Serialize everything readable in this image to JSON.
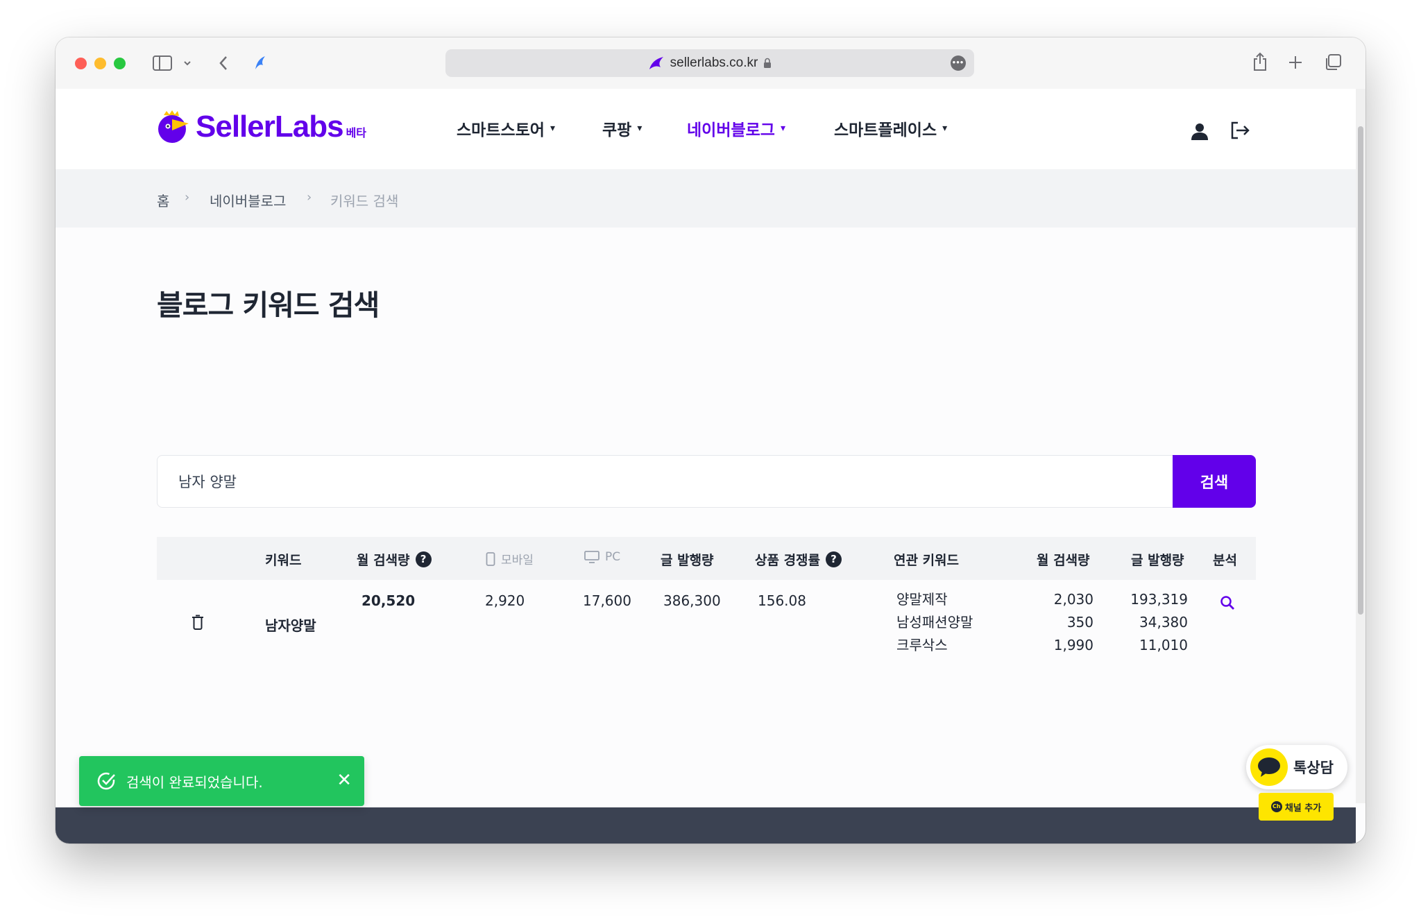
{
  "browser": {
    "url": "sellerlabs.co.kr",
    "more_icon": "ellipsis-icon"
  },
  "header": {
    "logo_text": "SellerLabs",
    "logo_badge": "베타",
    "nav": [
      {
        "label": "스마트스토어",
        "active": false
      },
      {
        "label": "쿠팡",
        "active": false
      },
      {
        "label": "네이버블로그",
        "active": true
      },
      {
        "label": "스마트플레이스",
        "active": false
      }
    ],
    "accent": "#6200ea"
  },
  "breadcrumb": {
    "home": "홈",
    "section": "네이버블로그",
    "current": "키워드 검색"
  },
  "page": {
    "title": "블로그 키워드 검색"
  },
  "search": {
    "value": "남자 양말",
    "button": "검색"
  },
  "table": {
    "headers": {
      "keyword": "키워드",
      "monthly_search": "월 검색량",
      "mobile": "모바일",
      "pc": "PC",
      "posts": "글 발행량",
      "competition": "상품 경쟁률",
      "related": "연관 키워드",
      "related_monthly": "월 검색량",
      "related_posts": "글 발행량",
      "analysis": "분석"
    },
    "row": {
      "keyword": "남자양말",
      "monthly_search": "20,520",
      "mobile": "2,920",
      "pc": "17,600",
      "posts": "386,300",
      "competition": "156.08",
      "related": [
        {
          "keyword": "양말제작",
          "monthly": "2,030",
          "posts": "193,319"
        },
        {
          "keyword": "남성패션양말",
          "monthly": "350",
          "posts": "34,380"
        },
        {
          "keyword": "크루삭스",
          "monthly": "1,990",
          "posts": "11,010"
        }
      ]
    },
    "help_glyph": "?"
  },
  "toast": {
    "message": "검색이 완료되었습니다.",
    "color": "#22c55e"
  },
  "kakao": {
    "label": "톡상담",
    "add_label": "채널 추가",
    "ch_label": "Ch"
  }
}
